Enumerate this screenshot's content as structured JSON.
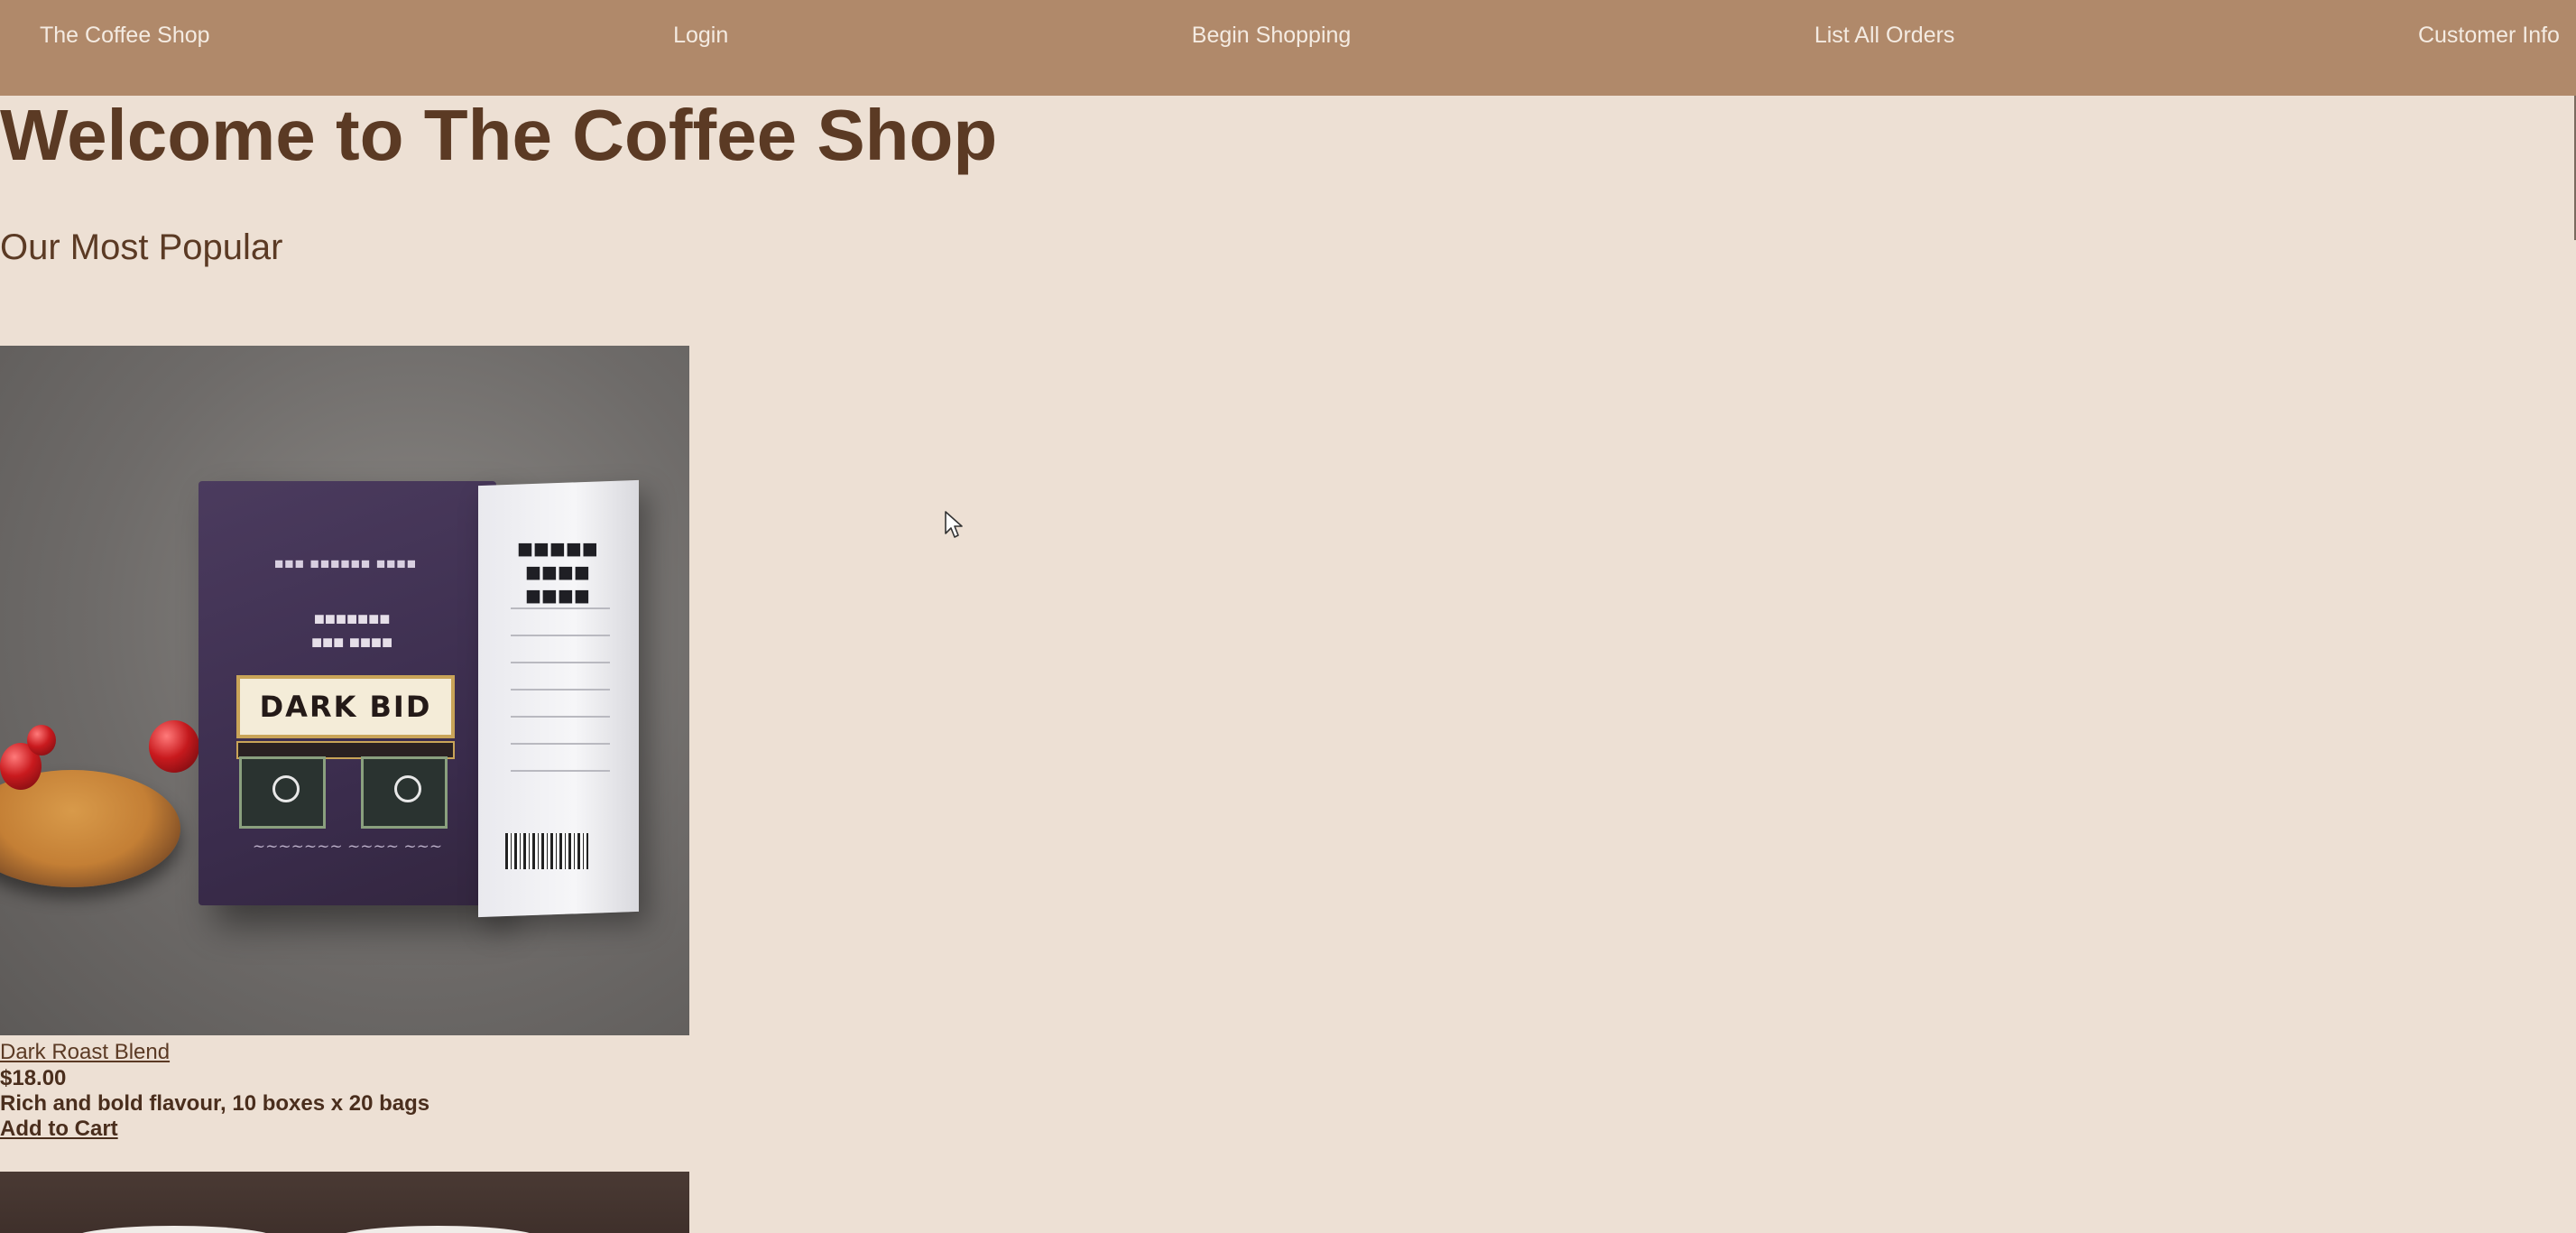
{
  "nav": {
    "brand": "The Coffee Shop",
    "login": "Login",
    "begin_shopping": "Begin Shopping",
    "list_orders": "List All Orders",
    "customer_info": "Customer Info"
  },
  "page": {
    "title": "Welcome to The Coffee Shop",
    "section_title": "Our Most Popular"
  },
  "product": {
    "name": "Dark Roast Blend",
    "price": "$18.00",
    "description": "Rich and bold flavour, 10 boxes x 20 bags",
    "add_to_cart": "Add to Cart",
    "image_label": "DARK BID"
  },
  "colors": {
    "navbar": "#b0896a",
    "background": "#ede0d4",
    "heading": "#5b3a24"
  },
  "icons": {
    "cursor": "mouse-pointer-icon"
  }
}
